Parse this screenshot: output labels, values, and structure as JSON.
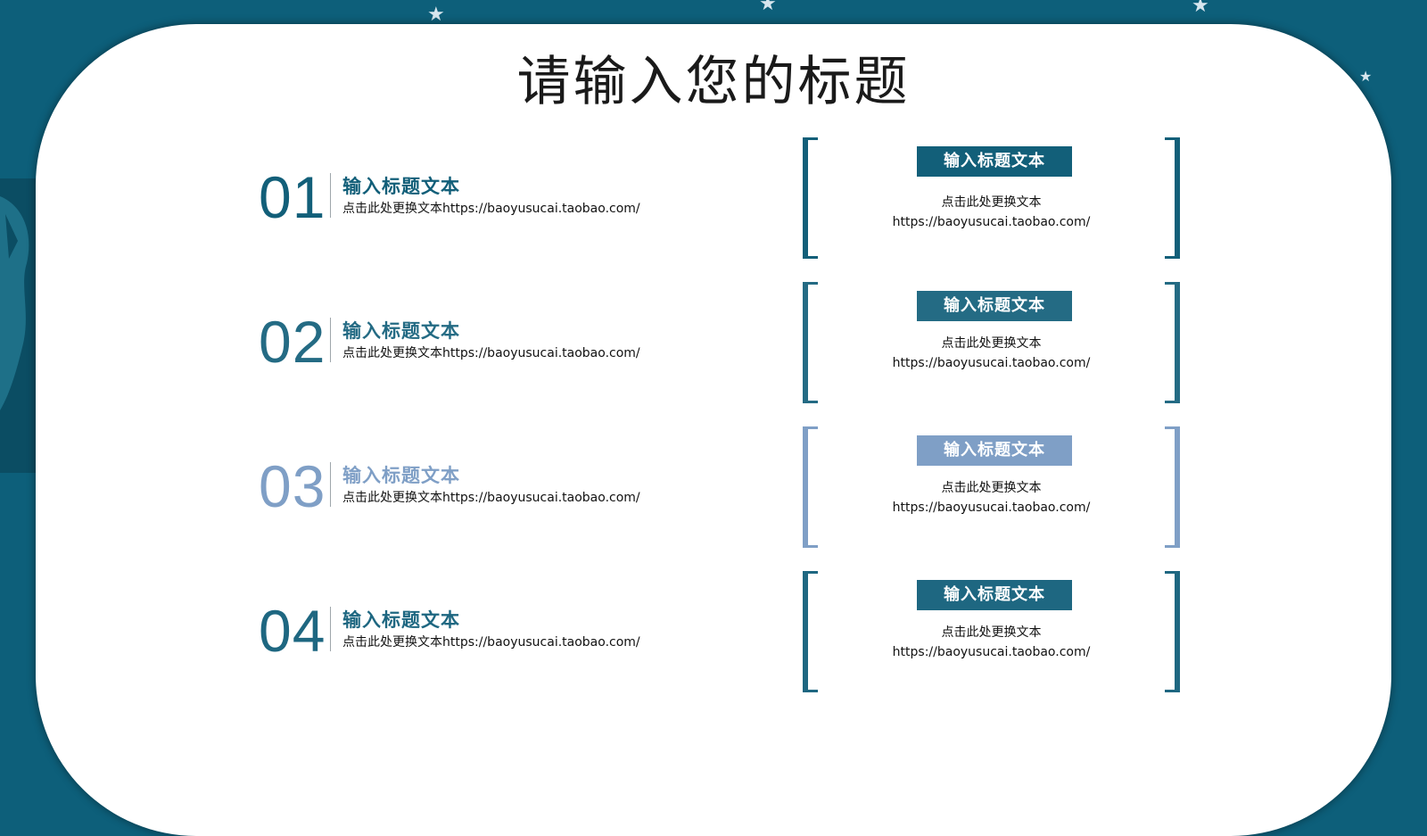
{
  "colors": {
    "background": "#0d5f7a",
    "accent_dark": "#125f79",
    "accent_mid": "#246b84",
    "accent_light": "#7f9fc6"
  },
  "slide": {
    "title": "请输入您的标题"
  },
  "left_items": [
    {
      "number": "01",
      "title": "输入标题文本",
      "desc": "点击此处更换文本https://baoyusucai.taobao.com/"
    },
    {
      "number": "02",
      "title": "输入标题文本",
      "desc": "点击此处更换文本https://baoyusucai.taobao.com/"
    },
    {
      "number": "03",
      "title": "输入标题文本",
      "desc": "点击此处更换文本https://baoyusucai.taobao.com/"
    },
    {
      "number": "04",
      "title": "输入标题文本",
      "desc": "点击此处更换文本https://baoyusucai.taobao.com/"
    }
  ],
  "right_cards": [
    {
      "label": "输入标题文本",
      "line1": "点击此处更换文本",
      "line2": "https://baoyusucai.taobao.com/"
    },
    {
      "label": "输入标题文本",
      "line1": "点击此处更换文本",
      "line2": "https://baoyusucai.taobao.com/"
    },
    {
      "label": "输入标题文本",
      "line1": "点击此处更换文本",
      "line2": "https://baoyusucai.taobao.com/"
    },
    {
      "label": "输入标题文本",
      "line1": "点击此处更换文本",
      "line2": "https://baoyusucai.taobao.com/"
    }
  ]
}
